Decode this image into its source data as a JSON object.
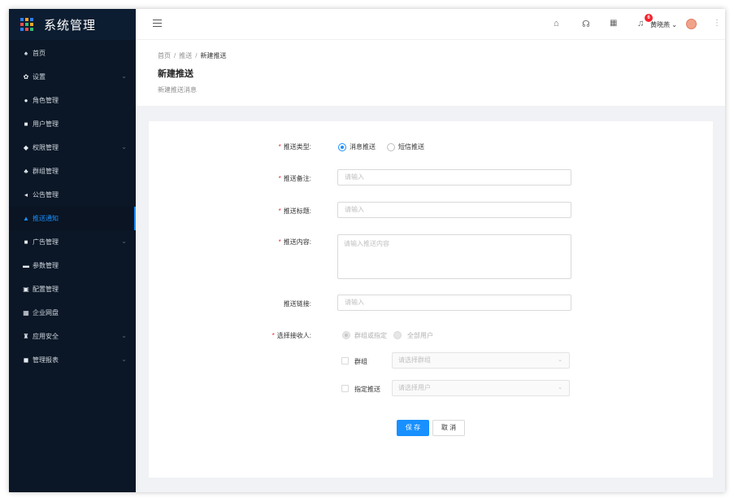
{
  "app": {
    "title": "系统管理"
  },
  "colors": {
    "sidebar_bg": "#0b1726",
    "accent": "#1890ff",
    "required": "#f5222d"
  },
  "sidebar": {
    "items": [
      {
        "label": "首页",
        "icon": "home-icon",
        "icon_glyph": "♠",
        "expandable": false
      },
      {
        "label": "设置",
        "icon": "gear-icon",
        "icon_glyph": "✿",
        "expandable": true
      },
      {
        "label": "角色管理",
        "icon": "role-icon",
        "icon_glyph": "●",
        "expandable": false
      },
      {
        "label": "用户管理",
        "icon": "user-card-icon",
        "icon_glyph": "■",
        "expandable": false
      },
      {
        "label": "权限管理",
        "icon": "shield-icon",
        "icon_glyph": "◆",
        "expandable": true
      },
      {
        "label": "群组管理",
        "icon": "group-icon",
        "icon_glyph": "♣",
        "expandable": false
      },
      {
        "label": "公告管理",
        "icon": "announcement-icon",
        "icon_glyph": "◂",
        "expandable": false
      },
      {
        "label": "推送通知",
        "icon": "bell-icon",
        "icon_glyph": "▲",
        "expandable": false,
        "active": true
      },
      {
        "label": "广告管理",
        "icon": "ad-icon",
        "icon_glyph": "■",
        "expandable": true
      },
      {
        "label": "参数管理",
        "icon": "params-icon",
        "icon_glyph": "▬",
        "expandable": false
      },
      {
        "label": "配置管理",
        "icon": "config-icon",
        "icon_glyph": "▣",
        "expandable": false
      },
      {
        "label": "企业网盘",
        "icon": "drive-icon",
        "icon_glyph": "▦",
        "expandable": false
      },
      {
        "label": "应用安全",
        "icon": "security-icon",
        "icon_glyph": "♜",
        "expandable": true
      },
      {
        "label": "管理报表",
        "icon": "report-icon",
        "icon_glyph": "◼",
        "expandable": true
      }
    ]
  },
  "header": {
    "username": "黄晓燕",
    "notification_count": "6",
    "icons": [
      "home-outline-icon",
      "headset-icon",
      "grid-icon",
      "bell-outline-icon",
      "more-icon"
    ]
  },
  "breadcrumb": {
    "items": [
      "首页",
      "推送"
    ],
    "current": "新建推送",
    "separator": "/"
  },
  "page": {
    "title": "新建推送",
    "description": "新建推送消息"
  },
  "form": {
    "type": {
      "label": "推送类型:",
      "options": [
        {
          "label": "消息推送",
          "selected": true
        },
        {
          "label": "短信推送",
          "selected": false
        }
      ]
    },
    "remark": {
      "label": "推送备注:",
      "placeholder": "请输入"
    },
    "title": {
      "label": "推送标题:",
      "placeholder": "请输入"
    },
    "content": {
      "label": "推送内容:",
      "placeholder": "请输入推送内容"
    },
    "link": {
      "label": "推送链接:",
      "placeholder": "请输入"
    },
    "receivers": {
      "label": "选择接收人:",
      "options": [
        {
          "label": "群组或指定",
          "selected": true,
          "disabled": true
        },
        {
          "label": "全部用户",
          "selected": false,
          "disabled": true
        }
      ],
      "group": {
        "label": "群组",
        "placeholder": "请选择群组"
      },
      "user": {
        "label": "指定推送",
        "placeholder": "请选择用户"
      }
    },
    "buttons": {
      "save": "保 存",
      "cancel": "取 消"
    }
  }
}
